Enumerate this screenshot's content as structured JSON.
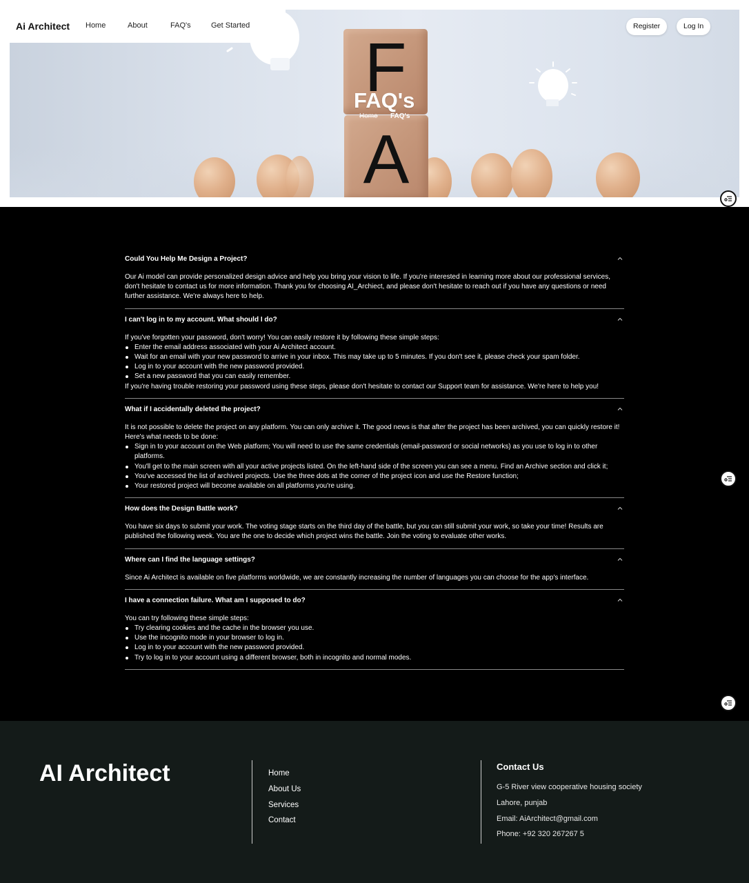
{
  "nav": {
    "brand": "Ai Architect",
    "links": [
      "Home",
      "About",
      "FAQ's",
      "Get Started"
    ],
    "register": "Register",
    "login": "Log In"
  },
  "hero": {
    "title": "FAQ's",
    "block_letters": [
      "F",
      "A"
    ],
    "breadcrumb": {
      "home": "Home",
      "current": "FAQ's"
    }
  },
  "faq": [
    {
      "question": "Could You Help Me Design a Project?",
      "intro": "Our Ai model can provide personalized design advice and help you bring your vision to life. If you're interested in learning more about our professional services, don't hesitate to contact us for more information. Thank you for choosing AI_Archiect, and please don't hesitate to reach out if you have any questions or need further assistance. We're always here to help.",
      "bullets": [],
      "outro": ""
    },
    {
      "question": "I can't log in to my account. What should I do?",
      "intro": "If you've forgotten your password, don't worry! You can easily restore it by following these simple steps:",
      "bullets": [
        "Enter the email address associated with your Ai Architect account.",
        "Wait for an email with your new password to arrive in your inbox. This may take up to 5 minutes. If you don't see it, please check your spam folder.",
        "Log in to your account with the new password provided.",
        "Set a new password that you can easily remember."
      ],
      "outro": "If you're having trouble restoring your password using these steps, please don't hesitate to contact our Support team for assistance. We're here to help you!"
    },
    {
      "question": "What if I accidentally deleted the project?",
      "intro": "It is not possible to delete the project on any platform. You can only archive it. The good news is that after the project has been archived, you can quickly restore it! Here's what needs to be done:",
      "bullets": [
        "Sign in to your account on the Web platform; You will need to use the same credentials (email-password or social networks) as you use to log in to other platforms.",
        "You'll get to the main screen with all your active projects listed. On the left-hand side of the screen you can see a menu. Find an Archive section and click it;",
        "You've accessed the list of archived projects. Use the three dots at the corner of the project icon and use the Restore function;",
        "Your restored project will become available on all platforms you're using."
      ],
      "outro": ""
    },
    {
      "question": "How does the Design Battle work?",
      "intro": "You have six days to submit your work. The voting stage starts on the third day of the battle, but you can still submit your work, so take your time! Results are published the following week. You are the one to decide which project wins the battle. Join the voting to evaluate other works.",
      "bullets": [],
      "outro": ""
    },
    {
      "question": "Where can I find the language settings?",
      "intro": "Since Ai Architect is available on five platforms worldwide, we are constantly increasing the number of languages you can choose for the app's interface.",
      "bullets": [],
      "outro": ""
    },
    {
      "question": "I have a connection failure. What am I supposed to do?",
      "intro": "You can try following these simple steps:",
      "bullets": [
        "Try clearing cookies and the cache in the browser you use.",
        "Use the incognito mode in your browser to log in.",
        "Log in to your account with the new password provided.",
        "Try to log in to your account using a different browser, both in incognito and normal modes."
      ],
      "outro": ""
    }
  ],
  "footer": {
    "brand": "AI Architect",
    "links": [
      "Home",
      "About Us",
      "Services",
      "Contact"
    ],
    "contact_heading": "Contact Us",
    "contact_lines": [
      "G-5 River view cooperative housing society",
      "Lahore, punjab",
      "Email: AiArchitect@gmail.com",
      "Phone: +92 320 267267 5"
    ]
  },
  "icons": {
    "floating": "filter-settings-icon",
    "chevron": "chevron-up-icon"
  }
}
